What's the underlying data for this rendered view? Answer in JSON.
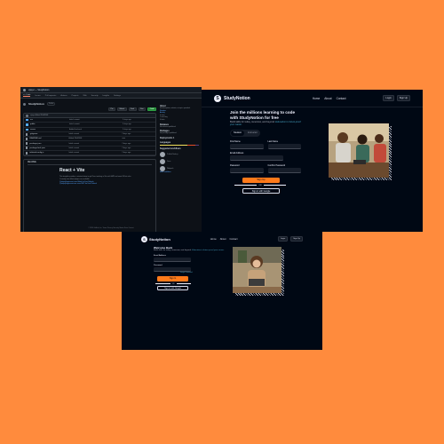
{
  "github": {
    "crumb": "vijayv/ — StudyNotion",
    "tabs": [
      "<> Code",
      "Issues",
      "Pull requests",
      "Actions",
      "Projects",
      "Wiki",
      "Security",
      "Insights",
      "Settings"
    ],
    "repo_name": "StudyNotion",
    "visibility": "Public",
    "buttons": {
      "pin": "Pin",
      "watch": "Watch",
      "fork": "Fork",
      "star": "Star",
      "code": "Code"
    },
    "commit_text": "vijayv Added README",
    "files": [
      {
        "name": "src",
        "kind": "folder",
        "msg": "Initial commit",
        "date": "2 days ago"
      },
      {
        "name": "public",
        "kind": "folder",
        "msg": "Initial commit",
        "date": "2 days ago"
      },
      {
        "name": "server",
        "kind": "folder",
        "msg": "Added backend",
        "date": "2 days ago"
      },
      {
        "name": ".gitignore",
        "kind": "file",
        "msg": "Initial commit",
        "date": "2 days ago"
      },
      {
        "name": "README.md",
        "kind": "file",
        "msg": "Added README",
        "date": "now"
      },
      {
        "name": "package.json",
        "kind": "file",
        "msg": "Initial commit",
        "date": "2 days ago"
      },
      {
        "name": "package-lock.json",
        "kind": "file",
        "msg": "Initial commit",
        "date": "2 days ago"
      },
      {
        "name": "tailwind.config.js",
        "kind": "file",
        "msg": "Initial commit",
        "date": "2 days ago"
      }
    ],
    "readme_header": "README",
    "readme_title": "React + Vite",
    "readme_lines": [
      "This template provides a minimal setup to get React working in Vite with HMR and some ESLint rules.",
      "Currently, two official plugins are available:"
    ],
    "readme_links": [
      "@vitejs/plugin-react uses Babel for Fast Refresh",
      "@vitejs/plugin-react-swc uses SWC for Fast Refresh"
    ],
    "side": {
      "about_h": "About",
      "about_t": "No description, website, or topics provided.",
      "stats": [
        "Readme",
        "Activity",
        "0 stars",
        "1 watching",
        "0 forks"
      ],
      "releases_h": "Releases",
      "releases_t": "No releases published",
      "packages_h": "Packages",
      "packages_t": "No packages published",
      "deployments_h": "Deployments 1",
      "languages_h": "Languages",
      "contributors_h": "Suggested workflows",
      "contributors": [
        "Publish Node.js",
        "Deno",
        "Webpack"
      ],
      "more": "More workflows"
    },
    "footer": "© 2024 GitHub, Inc.   Terms   Privacy   Security   Status   Docs   Contact"
  },
  "signup": {
    "logo_mark": "S",
    "logo_text": "StudyNotion",
    "nav_links": [
      "Home",
      "About",
      "Contact"
    ],
    "nav_buttons": [
      "Login",
      "Sign Up"
    ],
    "title": "Join the millions learning to code with StudyNotion for free",
    "sub_plain": "Build skills for today, tomorrow, and beyond.",
    "sub_italic": "Education to future-proof your career.",
    "toggle": [
      "Student",
      "Instructor"
    ],
    "first_name": "First Name",
    "last_name": "Last Name",
    "email": "Email Address",
    "password": "Password",
    "confirm": "Confirm Password",
    "submit": "Sign Up",
    "or": "OR",
    "google": "Sign in with Google"
  },
  "login": {
    "logo_mark": "S",
    "logo_text": "StudyNotion",
    "nav_links": [
      "Home",
      "About",
      "Contact"
    ],
    "nav_buttons": [
      "Login",
      "Sign Up"
    ],
    "title": "Welcome Back",
    "sub_plain": "Build skills for today, tomorrow, and beyond.",
    "sub_italic": "Education to future-proof your career.",
    "email": "Email Address",
    "password": "Password",
    "forgot": "Forgot Password",
    "submit": "Sign In",
    "or": "OR",
    "google": "Sign in with Google"
  },
  "colors": {
    "background": "#ff8b3d",
    "accent": "#ff7a1a",
    "panel": "#000814"
  }
}
